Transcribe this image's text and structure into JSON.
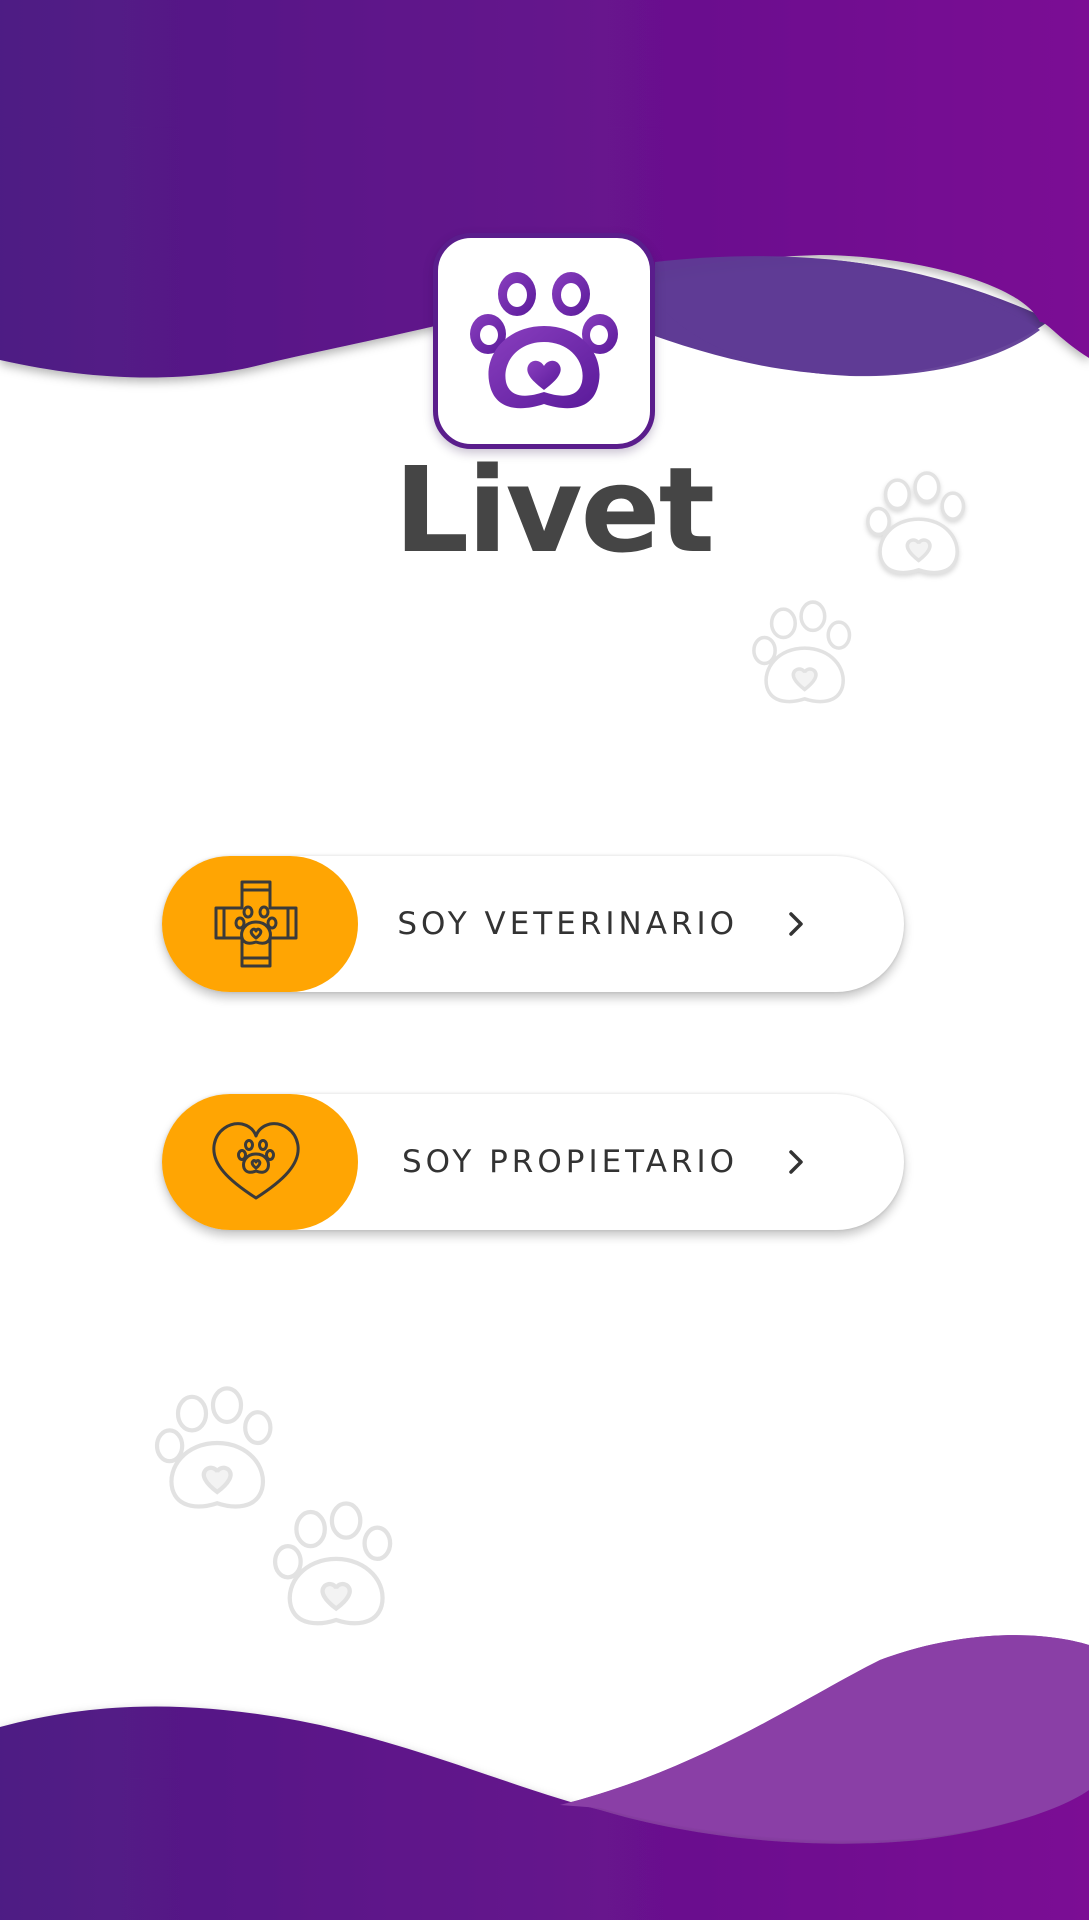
{
  "app": {
    "brand_name": "Livet"
  },
  "theme": {
    "purple_dark": "#4e1c84",
    "purple_bright": "#7b0a94",
    "purple_light": "#8a3fa6",
    "accent_orange": "#ffa503",
    "text_dark": "#333333",
    "logo_text": "#454545"
  },
  "logo": {
    "icon": "paw-heart-icon"
  },
  "role_buttons": [
    {
      "label": "SOY VETERINARIO",
      "icon": "vet-cross-paw-icon",
      "chevron": "chevron-right-icon"
    },
    {
      "label": "SOY PROPIETARIO",
      "icon": "heart-paw-icon",
      "chevron": "chevron-right-icon"
    }
  ]
}
